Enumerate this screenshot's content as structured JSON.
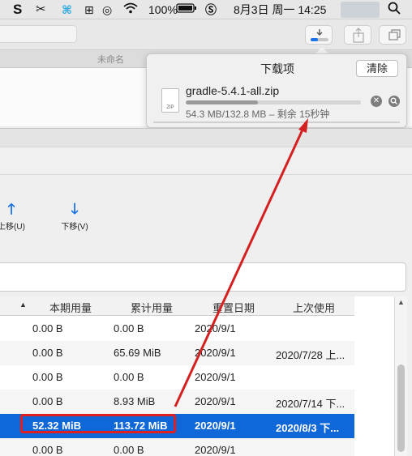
{
  "menubar": {
    "battery": "100%",
    "date_time": "8月3日 周一  14:25"
  },
  "tab": {
    "title": "未命名"
  },
  "downloads": {
    "title": "下载项",
    "clear_label": "清除",
    "file_name": "gradle-5.4.1-all.zip",
    "file_type": "ZIP",
    "status": "54.3 MB/132.8 MB – 剩余 15秒钟",
    "progress_fraction": 0.41
  },
  "prefs": {
    "move_up_label": "上移(U)",
    "move_down_label": "下移(V)",
    "columns": [
      "本期用量",
      "累计用量",
      "重置日期",
      "上次使用"
    ],
    "rows": [
      [
        "0.00  B",
        "0.00  B",
        "2020/9/1",
        ""
      ],
      [
        "0.00  B",
        "65.69  MiB",
        "2020/9/1",
        "2020/7/28 上..."
      ],
      [
        "0.00  B",
        "0.00  B",
        "2020/9/1",
        ""
      ],
      [
        "0.00  B",
        "8.93  MiB",
        "2020/9/1",
        "2020/7/14 下..."
      ],
      [
        "52.32  MiB",
        "113.72  MiB",
        "2020/9/1",
        "2020/8/3 下..."
      ],
      [
        "0.00  B",
        "0.00  B",
        "2020/9/1",
        ""
      ]
    ],
    "selected_row": 4
  },
  "colors": {
    "accent": "#1067d8",
    "annotation": "#e02020"
  }
}
